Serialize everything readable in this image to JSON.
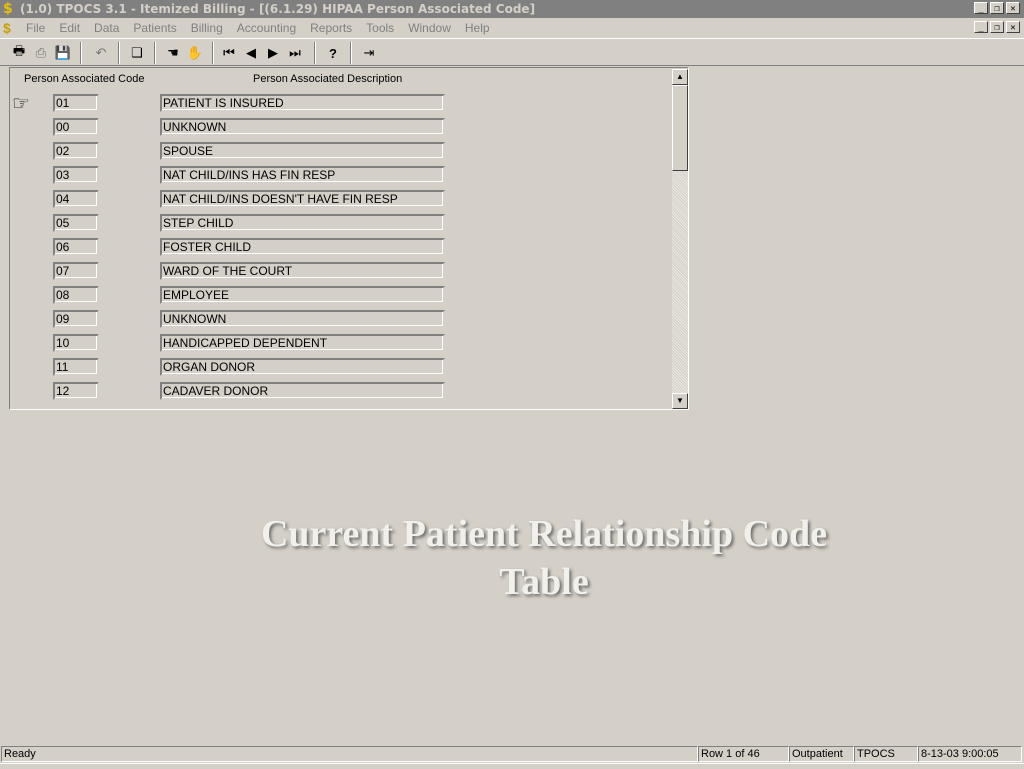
{
  "window": {
    "title": "(1.0) TPOCS 3.1 - Itemized Billing - [(6.1.29) HIPAA Person Associated Code]",
    "app_icon": "dollar-icon",
    "controls": [
      "_",
      "❐",
      "✕"
    ]
  },
  "menu": {
    "items": [
      "File",
      "Edit",
      "Data",
      "Patients",
      "Billing",
      "Accounting",
      "Reports",
      "Tools",
      "Window",
      "Help"
    ]
  },
  "toolbar": {
    "buttons": [
      {
        "icon": "printer-icon",
        "glyph": "🖶"
      },
      {
        "icon": "print-preview-icon",
        "glyph": "⎙"
      },
      {
        "icon": "save-icon",
        "glyph": "💾"
      },
      {
        "icon": "undo-icon",
        "glyph": "↶"
      },
      {
        "icon": "copy-records-icon",
        "glyph": "❏"
      },
      {
        "icon": "hand-select-icon",
        "glyph": "☚"
      },
      {
        "icon": "hand-stop-icon",
        "glyph": "✋"
      },
      {
        "icon": "first-record-icon",
        "glyph": "⏮"
      },
      {
        "icon": "previous-record-icon",
        "glyph": "◀"
      },
      {
        "icon": "next-record-icon",
        "glyph": "▶"
      },
      {
        "icon": "last-record-icon",
        "glyph": "⏭"
      },
      {
        "icon": "help-icon",
        "glyph": "?"
      },
      {
        "icon": "exit-door-icon",
        "glyph": "⇥"
      }
    ]
  },
  "grid": {
    "headers": {
      "code": "Person Associated Code",
      "description": "Person Associated Description"
    },
    "current_row_icon": "pointing-hand-icon",
    "rows": [
      {
        "code": "01",
        "description": "PATIENT IS INSURED"
      },
      {
        "code": "00",
        "description": "UNKNOWN"
      },
      {
        "code": "02",
        "description": "SPOUSE"
      },
      {
        "code": "03",
        "description": "NAT CHILD/INS HAS FIN RESP"
      },
      {
        "code": "04",
        "description": "NAT CHILD/INS DOESN'T HAVE FIN RESP"
      },
      {
        "code": "05",
        "description": "STEP CHILD"
      },
      {
        "code": "06",
        "description": "FOSTER CHILD"
      },
      {
        "code": "07",
        "description": "WARD OF THE COURT"
      },
      {
        "code": "08",
        "description": "EMPLOYEE"
      },
      {
        "code": "09",
        "description": "UNKNOWN"
      },
      {
        "code": "10",
        "description": "HANDICAPPED DEPENDENT"
      },
      {
        "code": "11",
        "description": "ORGAN DONOR"
      },
      {
        "code": "12",
        "description": "CADAVER DONOR"
      }
    ]
  },
  "caption": {
    "line1": "Current Patient Relationship Code",
    "line2": "Table"
  },
  "status": {
    "message": "Ready",
    "row": "Row 1 of 46",
    "mode": "Outpatient",
    "system": "TPOCS",
    "datetime": "8-13-03 9:00:05"
  }
}
